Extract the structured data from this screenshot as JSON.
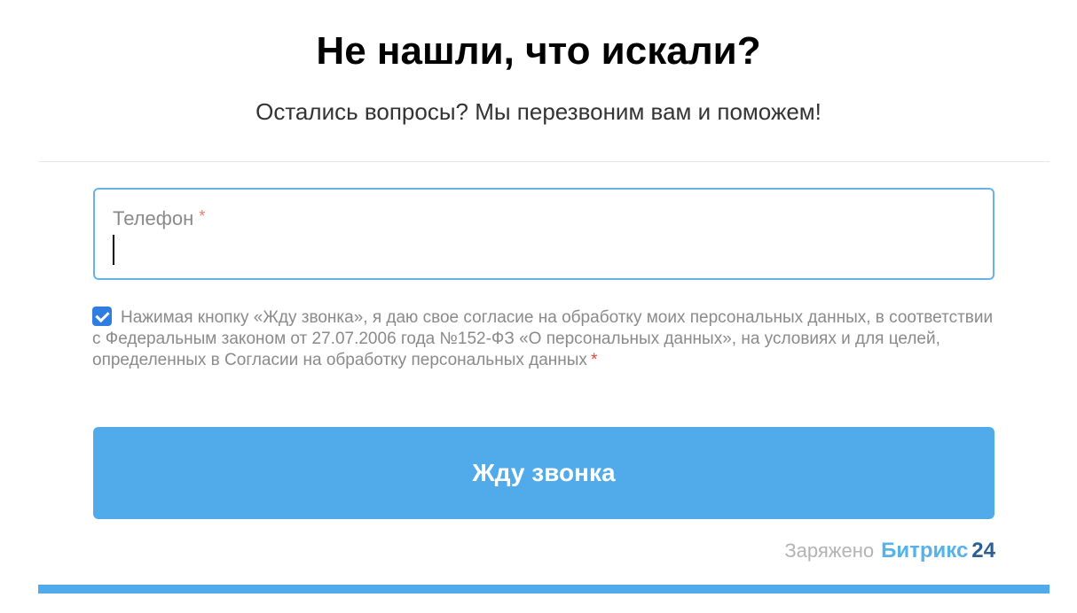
{
  "header": {
    "title": "Не нашли, что искали?",
    "subtitle": "Остались вопросы? Мы перезвоним вам и поможем!"
  },
  "form": {
    "phone_label": "Телефон",
    "phone_value": "",
    "required_mark": "*",
    "consent_checked": true,
    "consent_text": "Нажимая кнопку «Жду звонка», я даю свое согласие на обработку моих персональных данных, в соответствии с Федеральным законом от 27.07.2006 года №152-ФЗ «О персональных данных», на условиях и для целей, определенных в Согласии на обработку персональных данных",
    "submit_label": "Жду звонка"
  },
  "footer": {
    "powered_by": "Заряжено",
    "brand_name": "Битрикс",
    "brand_number": "24"
  },
  "colors": {
    "accent": "#51abea",
    "input_border": "#66b3ea",
    "checkbox": "#2f7de1",
    "required_red": "#e0493a",
    "brand_dark": "#2c5f94"
  }
}
